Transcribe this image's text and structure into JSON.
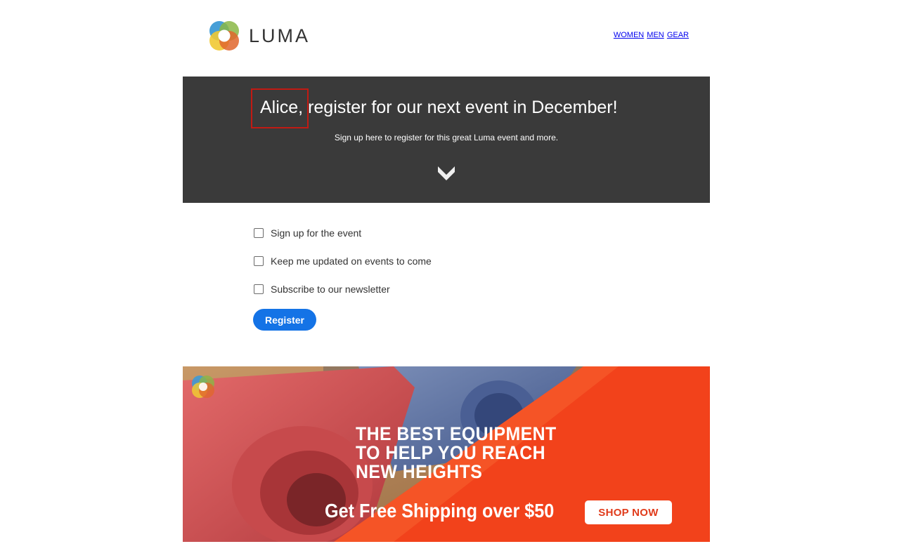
{
  "header": {
    "logo_text": "LUMA",
    "nav": [
      "WOMEN",
      "MEN",
      "GEAR"
    ]
  },
  "hero": {
    "title": "Alice, register for our next event in December!",
    "subtitle": "Sign up here to register for this great Luma event and more."
  },
  "form": {
    "options": [
      {
        "label": "Sign up for the event",
        "checked": false
      },
      {
        "label": "Keep me updated on events to come",
        "checked": false
      },
      {
        "label": "Subscribe to our newsletter",
        "checked": false
      }
    ],
    "register_label": "Register"
  },
  "banner": {
    "headline_line1": "THE BEST EQUIPMENT",
    "headline_line2": "TO HELP YOU REACH",
    "headline_line3": "NEW HEIGHTS",
    "shipping_text": "Get Free Shipping over $50",
    "cta_label": "SHOP NOW"
  },
  "colors": {
    "hero_bg": "#3a3a3a",
    "highlight_border": "#c11a13",
    "primary_button": "#1473e6",
    "banner_orange": "#f2421b",
    "link": "#0000ee"
  }
}
